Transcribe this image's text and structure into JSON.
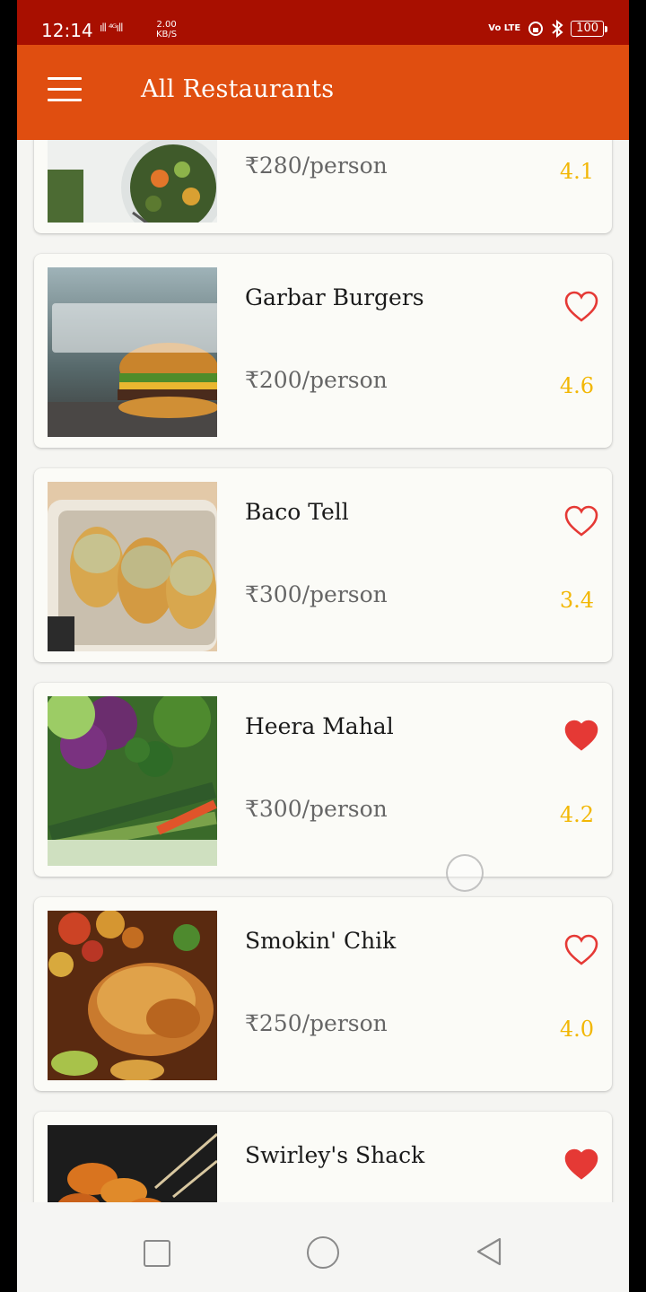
{
  "status_bar": {
    "time": "12:14",
    "signal": "ıll ⁴ᴳıll",
    "speed_value": "2.00",
    "speed_unit": "KB/S",
    "volte": "Vo LTE",
    "battery": "100"
  },
  "app_bar": {
    "title": "All Restaurants",
    "menu_icon": "hamburger-menu-icon"
  },
  "restaurants": [
    {
      "name": "",
      "price": "280/person",
      "rating": "4.1",
      "favorite": null
    },
    {
      "name": "Garbar Burgers",
      "price": "200/person",
      "rating": "4.6",
      "favorite": false
    },
    {
      "name": "Baco Tell",
      "price": "300/person",
      "rating": "3.4",
      "favorite": false
    },
    {
      "name": "Heera Mahal",
      "price": "300/person",
      "rating": "4.2",
      "favorite": true
    },
    {
      "name": "Smokin' Chik",
      "price": "250/person",
      "rating": "4.0",
      "favorite": false
    },
    {
      "name": "Swirley's Shack",
      "price": "",
      "rating": "",
      "favorite": true
    }
  ],
  "currency_symbol": "₹",
  "colors": {
    "status_bar": "#a80f00",
    "app_bar": "#e04e10",
    "rating": "#f2b705",
    "favorite": "#e53935"
  },
  "nav_bar": {
    "recent_icon": "square-recent-apps-icon",
    "home_icon": "circle-home-icon",
    "back_icon": "triangle-back-icon"
  }
}
